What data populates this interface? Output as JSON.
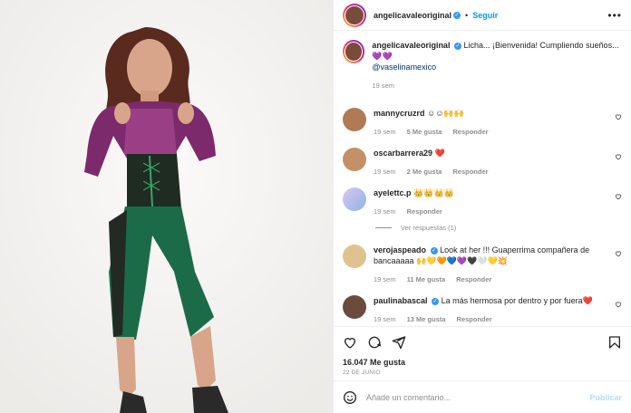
{
  "post_author": {
    "username": "angelicavaleoriginal",
    "follow_label": "Seguir",
    "dot": "•"
  },
  "caption": {
    "username": "angelicavaleoriginal",
    "text": "Licha... ¡Bienvenida! Cumpliendo sueños... 💜💜",
    "mention": "@vaselinamexico",
    "time": "19 sem"
  },
  "comments": [
    {
      "username": "mannycruzrd",
      "verified": false,
      "text": "☺☺🙌🙌",
      "time": "19 sem",
      "likes": "5 Me gusta",
      "reply": "Responder"
    },
    {
      "username": "oscarbarrera29",
      "verified": false,
      "text": "❤️",
      "time": "19 sem",
      "likes": "2 Me gusta",
      "reply": "Responder"
    },
    {
      "username": "ayelettc.p",
      "verified": false,
      "text": "👑👑👑👑",
      "time": "19 sem",
      "likes": "",
      "reply": "Responder"
    },
    {
      "username": "verojaspeado",
      "verified": true,
      "text": "Look at her !!! Guaperrima compañera de bancaaaaa 🙌💛🧡💙💜🖤🤍💛💥",
      "time": "19 sem",
      "likes": "11 Me gusta",
      "reply": "Responder"
    },
    {
      "username": "paulinabascal",
      "verified": true,
      "text": "La más hermosa por dentro y por fuera❤️",
      "time": "19 sem",
      "likes": "13 Me gusta",
      "reply": "Responder"
    }
  ],
  "view_replies": "Ver respuestas (1)",
  "likes_count": "16.047 Me gusta",
  "date": "22 DE JUNIO",
  "add_comment": {
    "placeholder": "Añade un comentario...",
    "publish": "Publicar"
  },
  "colors": {
    "accent": "#0095f6",
    "heart": "#ed4956",
    "muted": "#8e8e8e"
  }
}
